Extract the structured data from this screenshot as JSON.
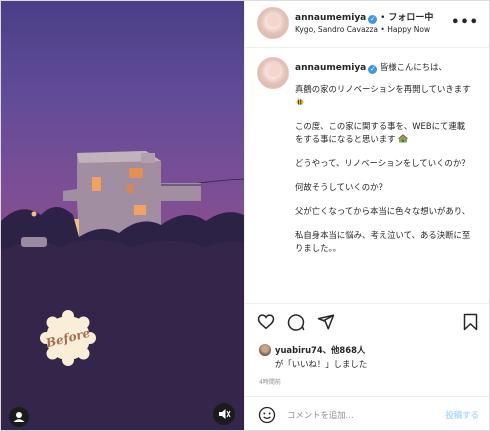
{
  "media": {
    "badge_text": "Before",
    "icons": {
      "tag": "user-tag-icon",
      "mute": "speaker-muted-icon"
    }
  },
  "header": {
    "username": "annaumemiya",
    "separator": "•",
    "follow_label": "フォロー中",
    "music": "Kygo, Sandro Cavazza • Happy Now",
    "more_icon": "more-options-icon"
  },
  "caption": {
    "username": "annaumemiya",
    "first_line": "皆様こんにちは、",
    "paragraphs": [
      "真鶴の家のリノベーションを再開していきます",
      "この度、この家に関する事を、WEBにて連載をする事になると思います",
      "どうやって、リノベーションをしていくのか？",
      "何故そうしていくのか？",
      "父が亡くなってから本当に色々な想いがあり、",
      "私自身本当に悩み、考え泣いて、ある決断に至りました。。"
    ]
  },
  "actions": {
    "icons": [
      "heart-icon",
      "comment-icon",
      "share-icon",
      "bookmark-icon"
    ]
  },
  "likes": {
    "user": "yuabiru74",
    "others": "、他868人",
    "suffix": "が「いいね！」しました"
  },
  "time": "4時間前",
  "comment": {
    "placeholder": "コメントを追加...",
    "post_label": "投稿する"
  },
  "colors": {
    "accent": "#3897f0",
    "post_disabled": "#b3dbff",
    "text": "#262626",
    "muted": "#8e8e8e"
  }
}
